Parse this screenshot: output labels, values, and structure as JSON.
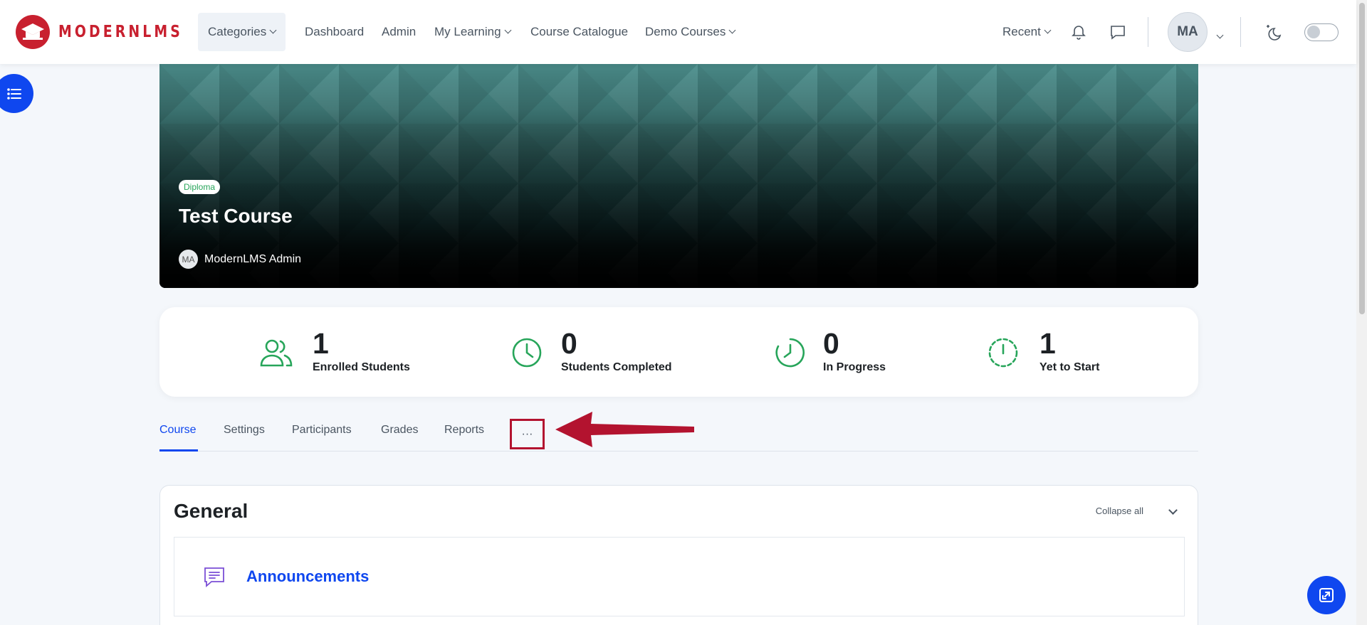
{
  "brand": {
    "name": "MODERNLMS",
    "color": "#c8202f"
  },
  "nav": {
    "categories": "Categories",
    "dashboard": "Dashboard",
    "admin": "Admin",
    "my_learning": "My Learning",
    "catalogue": "Course Catalogue",
    "demo_courses": "Demo Courses",
    "recent": "Recent",
    "avatar_initials": "MA"
  },
  "course": {
    "badge": "Diploma",
    "title": "Test Course",
    "teacher_initials": "MA",
    "teacher_name": "ModernLMS Admin"
  },
  "stats": [
    {
      "value": "1",
      "label": "Enrolled Students",
      "icon": "users-icon"
    },
    {
      "value": "0",
      "label": "Students Completed",
      "icon": "clock-icon"
    },
    {
      "value": "0",
      "label": "In Progress",
      "icon": "progress-clock-icon"
    },
    {
      "value": "1",
      "label": "Yet to Start",
      "icon": "dashed-clock-icon"
    }
  ],
  "tabs": {
    "course": "Course",
    "settings": "Settings",
    "participants": "Participants",
    "grades": "Grades",
    "reports": "Reports",
    "more": "···"
  },
  "section": {
    "title": "General",
    "collapse_all": "Collapse all",
    "activity_name": "Announcements"
  },
  "colors": {
    "accent": "#0f47ef",
    "success": "#27a55a",
    "annotation": "#b3132f"
  }
}
